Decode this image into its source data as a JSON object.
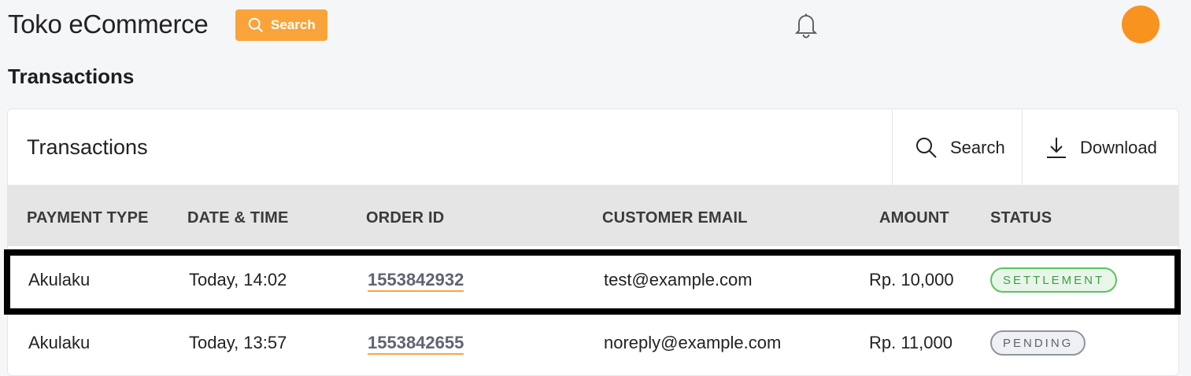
{
  "app": {
    "title": "Toko eCommerce",
    "search_label": "Search"
  },
  "page": {
    "title": "Transactions"
  },
  "card": {
    "title": "Transactions",
    "search_label": "Search",
    "download_label": "Download"
  },
  "table": {
    "headers": [
      "PAYMENT TYPE",
      "DATE & TIME",
      "ORDER ID",
      "CUSTOMER EMAIL",
      "AMOUNT",
      "STATUS"
    ],
    "rows": [
      {
        "payment_type": "Akulaku",
        "datetime": "Today, 14:02",
        "order_id": "1553842932",
        "email": "test@example.com",
        "amount": "Rp. 10,000",
        "status": "SETTLEMENT"
      },
      {
        "payment_type": "Akulaku",
        "datetime": "Today, 13:57",
        "order_id": "1553842655",
        "email": "noreply@example.com",
        "amount": "Rp. 11,000",
        "status": "PENDING"
      }
    ]
  },
  "icons": {
    "search": "search-icon",
    "bell": "bell-icon",
    "download": "download-icon",
    "avatar": "avatar"
  },
  "colors": {
    "accent": "#f9a43a",
    "avatar": "#f7931e",
    "settlement": "#5cc15f",
    "pending": "#8f959d"
  }
}
